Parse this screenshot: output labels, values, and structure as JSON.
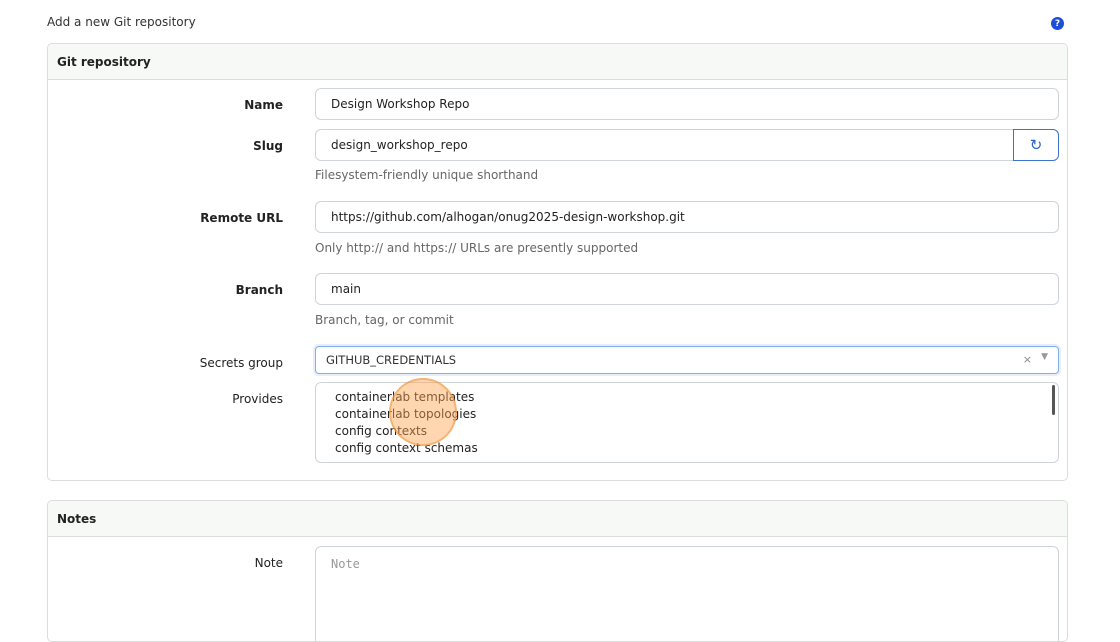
{
  "page_title": "Add a new Git repository",
  "help_icon": "?",
  "git_panel": {
    "title": "Git repository",
    "name": {
      "label": "Name",
      "value": "Design Workshop Repo"
    },
    "slug": {
      "label": "Slug",
      "value": "design_workshop_repo",
      "help": "Filesystem-friendly unique shorthand",
      "refresh_icon": "↻"
    },
    "remote_url": {
      "label": "Remote URL",
      "value": "https://github.com/alhogan/onug2025-design-workshop.git",
      "help": "Only http:// and https:// URLs are presently supported"
    },
    "branch": {
      "label": "Branch",
      "value": "main",
      "help": "Branch, tag, or commit"
    },
    "secrets_group": {
      "label": "Secrets group",
      "value": "GITHUB_CREDENTIALS",
      "clear": "×",
      "caret": "▼"
    },
    "provides": {
      "label": "Provides",
      "options": [
        "containerlab templates",
        "containerlab topologies",
        "config contexts",
        "config context schemas"
      ]
    }
  },
  "notes_panel": {
    "title": "Notes",
    "note": {
      "label": "Note",
      "placeholder": "Note"
    }
  },
  "colors": {
    "accent": "#3d73cf",
    "help_icon": "#1a4fd6",
    "cursor_highlight": "#f5a550"
  }
}
